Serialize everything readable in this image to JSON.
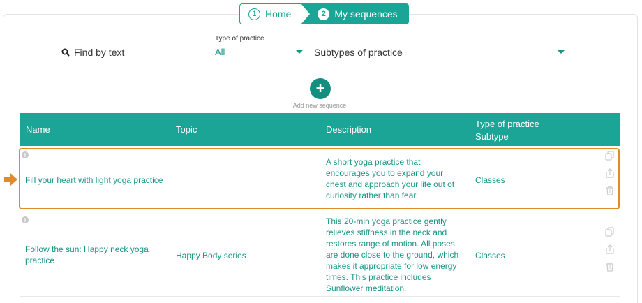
{
  "breadcrumb": {
    "steps": [
      {
        "number": "1",
        "label": "Home"
      },
      {
        "number": "2",
        "label": "My sequences"
      }
    ]
  },
  "filters": {
    "search_label": "Find by text",
    "type_label": "Type of practice",
    "type_value": "All",
    "subtype_value": "Subtypes of practice"
  },
  "add": {
    "label": "Add new sequence",
    "symbol": "+"
  },
  "table": {
    "headers": {
      "name": "Name",
      "topic": "Topic",
      "description": "Description",
      "type": "Type of practice",
      "subtype": "Subtype"
    },
    "rows": [
      {
        "name": "Fill your heart with light yoga practice",
        "topic": "",
        "description": "A short yoga practice that encourages you to expand your chest and approach your life out of curiosity rather than fear.",
        "type": "Classes"
      },
      {
        "name": "Follow the sun: Happy neck yoga practice",
        "topic": "Happy Body series",
        "description": "This 20-min yoga practice gently relieves stiffness in the neck and restores range of motion. All poses are done close to the ground, which makes it appropriate for low energy times. This practice includes Sunflower meditation.",
        "type": "Classes"
      }
    ]
  },
  "colors": {
    "accent": "#1aa596",
    "highlight": "#e08a2c"
  }
}
